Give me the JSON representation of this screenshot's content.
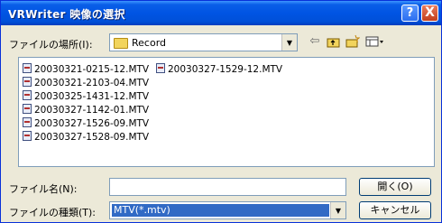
{
  "window": {
    "title": "VRWriter 映像の選択"
  },
  "title_buttons": {
    "help": "?",
    "close": "X"
  },
  "location": {
    "label": "ファイルの場所(I):",
    "value": "Record"
  },
  "files": [
    "20030321-0215-12.MTV",
    "20030321-2103-04.MTV",
    "20030325-1431-12.MTV",
    "20030327-1142-01.MTV",
    "20030327-1526-09.MTV",
    "20030327-1528-09.MTV",
    "20030327-1529-12.MTV"
  ],
  "filename": {
    "label": "ファイル名(N):",
    "value": ""
  },
  "filetype": {
    "label": "ファイルの種類(T):",
    "value": "MTV(*.mtv)"
  },
  "buttons": {
    "open": "開く(O)",
    "cancel": "キャンセル"
  },
  "icons": [
    "back-arrow-icon",
    "up-folder-icon",
    "new-folder-icon",
    "view-menu-icon"
  ]
}
